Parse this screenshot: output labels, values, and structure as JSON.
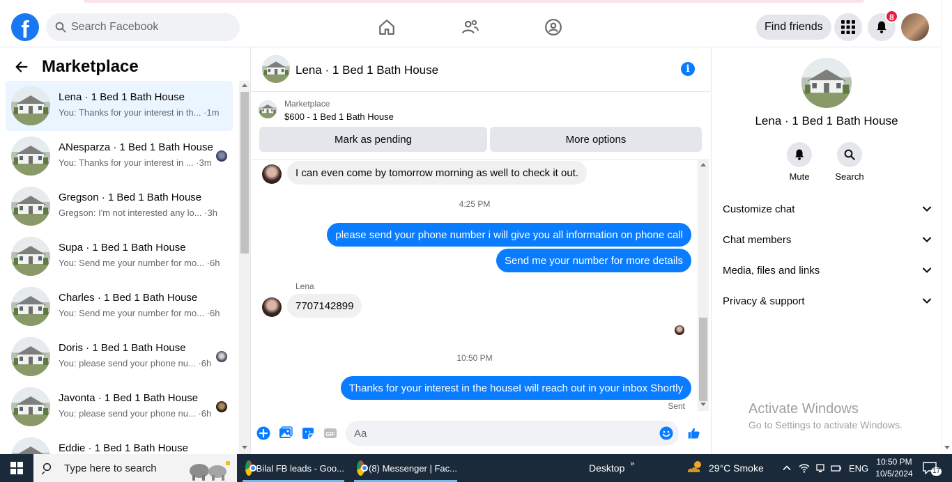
{
  "topbar": {
    "logo": "f",
    "search_placeholder": "Search Facebook",
    "nav_icons": [
      "home-icon",
      "friends-icon",
      "groups-icon"
    ],
    "find_friends": "Find friends",
    "notification_count": "8"
  },
  "sidebar": {
    "title": "Marketplace",
    "conversations": [
      {
        "name": "Lena · 1 Bed 1 Bath House",
        "snippet": "You: Thanks for your interest in th... ·1m",
        "active": true
      },
      {
        "name": "ANesparza · 1 Bed 1 Bath House",
        "snippet": "You: Thanks for your interest in ... ·3m"
      },
      {
        "name": "Gregson · 1 Bed 1 Bath House",
        "snippet": "Gregson: I'm not interested any lo... ·3h"
      },
      {
        "name": "Supa · 1 Bed 1 Bath House",
        "snippet": "You: Send me your number for mo... ·6h"
      },
      {
        "name": "Charles · 1 Bed 1 Bath House",
        "snippet": "You: Send me your number for mo... ·6h"
      },
      {
        "name": "Doris · 1 Bed 1 Bath House",
        "snippet": "You: please send your phone nu... ·6h"
      },
      {
        "name": "Javonta · 1 Bed 1 Bath House",
        "snippet": "You: please send your phone nu... ·6h"
      },
      {
        "name": "Eddie · 1 Bed 1 Bath House",
        "snippet": ""
      }
    ]
  },
  "chat": {
    "title": "Lena · 1 Bed 1 Bath House",
    "listing_source": "Marketplace",
    "listing_price": "$600 - 1 Bed 1 Bath House",
    "mark_pending": "Mark as pending",
    "more_options": "More options",
    "messages": [
      {
        "text": "I can even come by tomorrow morning as well to check it out.",
        "dir": "in"
      },
      {
        "text": "4:25 PM",
        "dir": "time"
      },
      {
        "text": "please send your phone number i will give you all information on phone call",
        "dir": "out"
      },
      {
        "text": "Send me your number for more details",
        "dir": "out"
      },
      {
        "text": "Lena",
        "dir": "sender"
      },
      {
        "text": "7707142899",
        "dir": "in"
      },
      {
        "text": "10:50 PM",
        "dir": "time"
      },
      {
        "text": "Thanks for your interest in the houseI will reach out in your inbox Shortly",
        "dir": "out"
      },
      {
        "text": "Sent",
        "dir": "status"
      }
    ],
    "input_placeholder": "Aa"
  },
  "details": {
    "name": "Lena · 1 Bed 1 Bath House",
    "mute": "Mute",
    "search": "Search",
    "sections": [
      "Customize chat",
      "Chat members",
      "Media, files and links",
      "Privacy & support"
    ],
    "watermark_title": "Activate Windows",
    "watermark_sub": "Go to Settings to activate Windows."
  },
  "taskbar": {
    "search_placeholder": "Type here to search",
    "apps": [
      "Bilal FB leads - Goo...",
      "(8) Messenger | Fac..."
    ],
    "desktop": "Desktop",
    "weather": "29°C  Smoke",
    "language": "ENG",
    "time": "10:50 PM",
    "date": "10/5/2024",
    "notif_count": "17"
  }
}
